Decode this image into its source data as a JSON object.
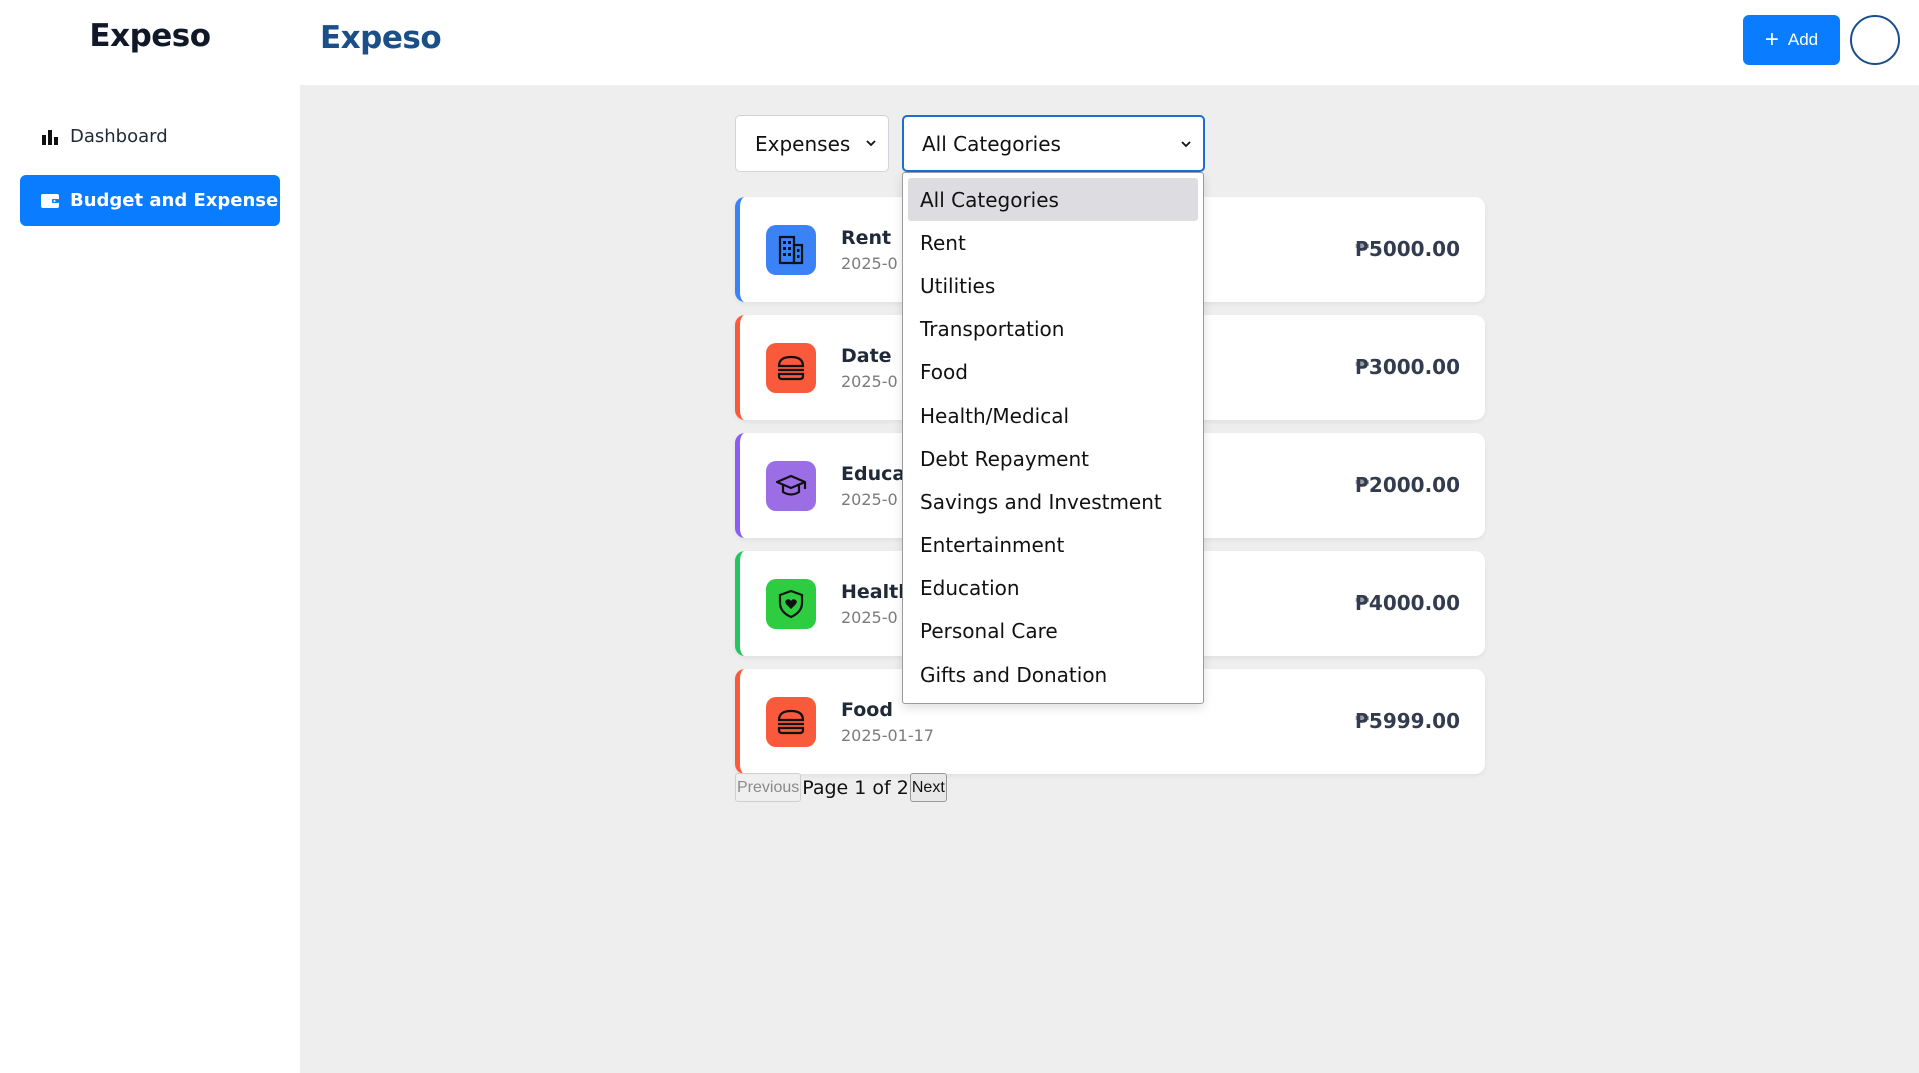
{
  "sidebar": {
    "brand": "Expeso",
    "items": [
      {
        "label": "Dashboard",
        "icon": "bar-chart-icon",
        "active": false
      },
      {
        "label": "Budget and Expense",
        "icon": "wallet-icon",
        "active": true
      }
    ]
  },
  "topbar": {
    "title": "Expeso",
    "add_label": "Add"
  },
  "filters": {
    "type_value": "Expenses",
    "category_value": "All Categories"
  },
  "expenses": [
    {
      "name": "Rent",
      "date": "2025-0",
      "amount": "₱5000.00",
      "color": "#3b82f6",
      "icon": "building-icon"
    },
    {
      "name": "Date",
      "date": "2025-0",
      "amount": "₱3000.00",
      "color": "#fa5a3c",
      "icon": "burger-icon"
    },
    {
      "name": "Educa",
      "date": "2025-0",
      "amount": "₱2000.00",
      "color": "#8b5cf6",
      "icon": "graduation-cap-icon"
    },
    {
      "name": "Health",
      "date": "2025-0",
      "amount": "₱4000.00",
      "color": "#22c55e",
      "icon": "shield-heart-icon"
    },
    {
      "name": "Food",
      "date": "2025-01-17",
      "amount": "₱5999.00",
      "color": "#fa5a3c",
      "icon": "burger-icon"
    }
  ],
  "pagination": {
    "prev_label": "Previous",
    "info": "Page 1 of 2",
    "next_label": "Next"
  },
  "category_dropdown": {
    "selected": "All Categories",
    "options": [
      "All Categories",
      "Rent",
      "Utilities",
      "Transportation",
      "Food",
      "Health/Medical",
      "Debt Repayment",
      "Savings and Investment",
      "Entertainment",
      "Education",
      "Personal Care",
      "Gifts and Donation"
    ]
  },
  "colors": {
    "primary": "#0a7cff",
    "title": "#1a4f8a",
    "main_bg": "#eeeeee"
  }
}
